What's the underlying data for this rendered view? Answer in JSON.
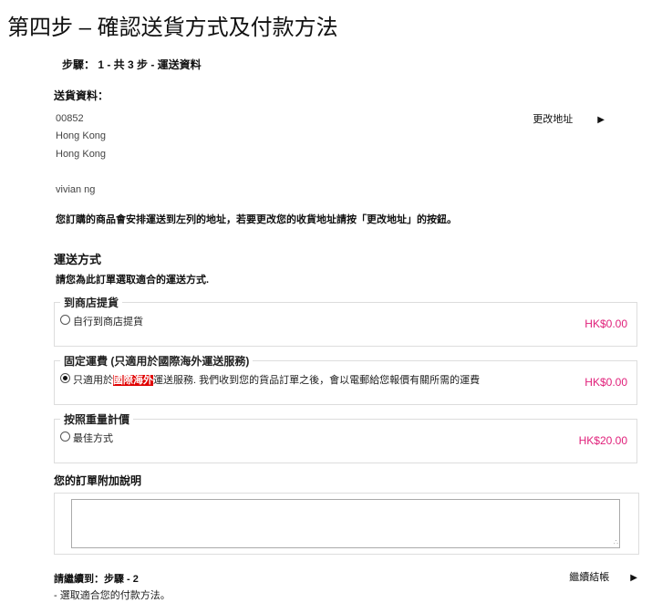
{
  "title": "第四步 – 確認送貨方式及付款方法",
  "step": {
    "text": "步驟： 1 - 共 3 步 - 運送資料"
  },
  "delivery": {
    "label": "送貨資料：",
    "address": [
      "00852",
      "Hong Kong",
      "Hong Kong"
    ],
    "name": "vivian ng",
    "change_label": "更改地址",
    "notice": "您訂購的商品會安排運送到左列的地址，若要更改您的收貨地址請按「更改地址」的按鈕。"
  },
  "shipping": {
    "title": "運送方式",
    "desc": "請您為此訂單選取適合的運送方式.",
    "options": [
      {
        "legend": "到商店提貨",
        "label": "自行到商店提貨",
        "price": "HK$0.00",
        "checked": false
      },
      {
        "legend": "固定運費 (只適用於國際海外運送服務)",
        "label_pre": "只適用於",
        "label_highlight": "國際海外",
        "label_post": "運送服務. 我們收到您的貨品訂單之後，會以電郵給您報價有關所需的運費",
        "price": "HK$0.00",
        "checked": true
      },
      {
        "legend": "按照重量計價",
        "label": "最佳方式",
        "price": "HK$20.00",
        "checked": false
      }
    ]
  },
  "notes": {
    "title": "您的訂單附加說明",
    "value": ""
  },
  "continue": {
    "label": "請繼續到：步驟 - 2",
    "sub": "- 選取適合您的付款方法。",
    "button": "繼續結帳"
  },
  "colors": {
    "price": "#e0207a",
    "highlight_bg": "#e00000"
  },
  "icons": {
    "arrow": "triangle-right-icon"
  }
}
